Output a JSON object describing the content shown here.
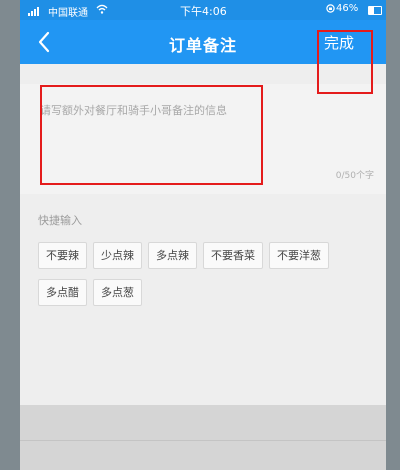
{
  "status_bar": {
    "carrier": "中国联通",
    "time": "下午4:06",
    "battery": "46%",
    "battery_level": 0.46
  },
  "nav": {
    "title": "订单备注",
    "done_label": "完成"
  },
  "note": {
    "placeholder": "请写额外对餐厅和骑手小哥备注的信息",
    "value": "",
    "counter": "0/50个字"
  },
  "quick_input": {
    "title": "快捷输入",
    "options": [
      "不要辣",
      "少点辣",
      "多点辣",
      "不要香菜",
      "不要洋葱",
      "多点醋",
      "多点葱"
    ]
  },
  "colors": {
    "nav_bg": "#2196f3",
    "highlight": "#e41b1b"
  }
}
